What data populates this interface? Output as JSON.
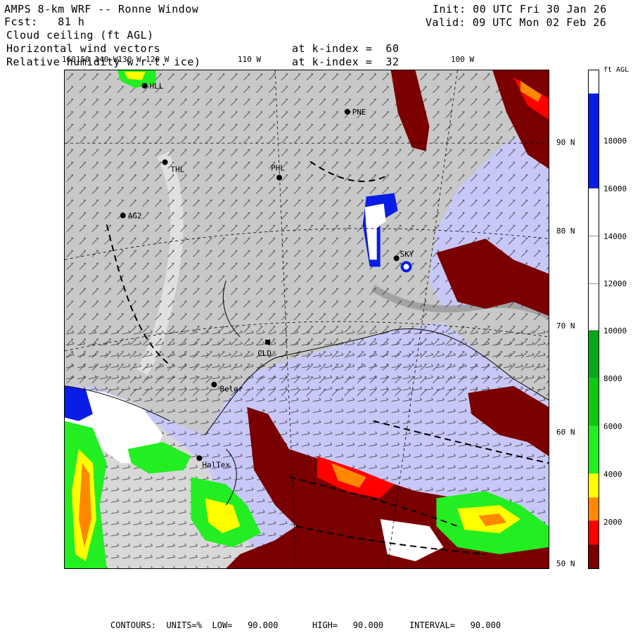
{
  "header": {
    "title": "AMPS 8-km WRF -- Ronne Window",
    "forecast": "Fcst:   81 h",
    "field1": "Cloud ceiling (ft AGL)",
    "field2": "Horizontal wind vectors",
    "field3": "Relative humidity w.r.t. ice)",
    "k_label_1": "at k-index =  60",
    "k_label_2": "at k-index =  32",
    "init": "Init: 00 UTC Fri 30 Jan 26",
    "valid": "Valid: 09 UTC Mon 02 Feb 26"
  },
  "longitude_labels": [
    "160150 140 W130 W 120 W",
    "110 W",
    "100 W"
  ],
  "latitude_labels": [
    "90 N",
    "80 N",
    "70 N",
    "60 N",
    "50 N"
  ],
  "colorbar": {
    "unit": "ft AGL",
    "ticks": [
      "18000",
      "16000",
      "14000",
      "12000",
      "10000",
      "8000",
      "6000",
      "4000",
      "2000"
    ],
    "colors": [
      "#ffffff",
      "#0a1de6",
      "#ffffff",
      "#ffffff",
      "#ffffff",
      "#08a81c",
      "#10c810",
      "#22ee22",
      "#ffff00",
      "#ff8800",
      "#ff0000",
      "#7a0000"
    ]
  },
  "stations": {
    "hll": "HLL",
    "pne": "PNE",
    "thl": "THL",
    "phl": "PHL",
    "ag2": "AG2",
    "sky": "SKY",
    "cld": "CLD",
    "belgr": "Belgr",
    "halley": "HalTex"
  },
  "colors": {
    "terrain": "#c8c8c8",
    "open_water": "#c8c8f8",
    "deep_red": "#7a0000",
    "red": "#ff0000",
    "orange": "#ff8800",
    "yellow": "#ffff00",
    "green": "#22ee22",
    "blue": "#0a1de6"
  },
  "footer": {
    "contours": "CONTOURS:  UNITS=%  LOW=   90.000",
    "high": "HIGH=   90.000",
    "interval": "INTERVAL=   90.000"
  }
}
